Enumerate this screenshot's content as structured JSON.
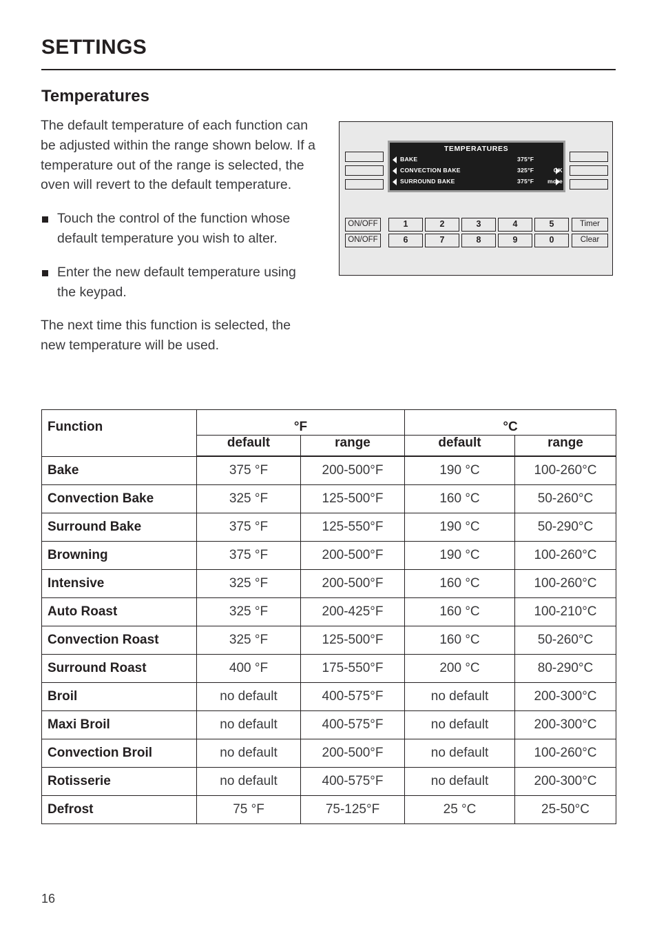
{
  "header": {
    "title": "SETTINGS"
  },
  "section": {
    "heading": "Temperatures",
    "intro": "The default temperature of each function can be adjusted within the range shown below. If a temperature out of the range is selected, the oven will revert to the default temperature.",
    "bullets": [
      "Touch the control of the function whose default temperature you wish to alter.",
      "Enter the new default temperature using the keypad."
    ],
    "closing": "The next time this function is selected, the new temperature will be used."
  },
  "control_panel": {
    "display": {
      "title": "TEMPERATURES",
      "rows": [
        {
          "label": "BAKE",
          "temp": "375°F",
          "action": ""
        },
        {
          "label": "CONVECTION BAKE",
          "temp": "325°F",
          "action": "OK"
        },
        {
          "label": "SURROUND BAKE",
          "temp": "375°F",
          "action": "more"
        }
      ]
    },
    "left_blank_buttons": [
      "",
      "",
      ""
    ],
    "right_blank_buttons": [
      "",
      "",
      ""
    ],
    "onoff_buttons": [
      "ON/OFF",
      "ON/OFF"
    ],
    "keypad_row1": [
      "1",
      "2",
      "3",
      "4",
      "5"
    ],
    "keypad_row2": [
      "6",
      "7",
      "8",
      "9",
      "0"
    ],
    "function_buttons": [
      "Timer",
      "Clear"
    ]
  },
  "table": {
    "headers": {
      "function": "Function",
      "fahrenheit": "°F",
      "celsius": "°C",
      "f_default": "default",
      "f_range": "range",
      "c_default": "default",
      "c_range": "range"
    },
    "rows": [
      {
        "function": "Bake",
        "f_default": "375 °F",
        "f_range": "200-500°F",
        "c_default": "190 °C",
        "c_range": "100-260°C"
      },
      {
        "function": "Convection Bake",
        "f_default": "325 °F",
        "f_range": "125-500°F",
        "c_default": "160 °C",
        "c_range": "50-260°C"
      },
      {
        "function": "Surround Bake",
        "f_default": "375 °F",
        "f_range": "125-550°F",
        "c_default": "190 °C",
        "c_range": "50-290°C"
      },
      {
        "function": "Browning",
        "f_default": "375 °F",
        "f_range": "200-500°F",
        "c_default": "190 °C",
        "c_range": "100-260°C"
      },
      {
        "function": "Intensive",
        "f_default": "325 °F",
        "f_range": "200-500°F",
        "c_default": "160 °C",
        "c_range": "100-260°C"
      },
      {
        "function": "Auto Roast",
        "f_default": "325 °F",
        "f_range": "200-425°F",
        "c_default": "160 °C",
        "c_range": "100-210°C"
      },
      {
        "function": "Convection Roast",
        "f_default": "325 °F",
        "f_range": "125-500°F",
        "c_default": "160 °C",
        "c_range": "50-260°C"
      },
      {
        "function": "Surround Roast",
        "f_default": "400 °F",
        "f_range": "175-550°F",
        "c_default": "200 °C",
        "c_range": "80-290°C"
      },
      {
        "function": "Broil",
        "f_default": "no default",
        "f_range": "400-575°F",
        "c_default": "no default",
        "c_range": "200-300°C"
      },
      {
        "function": "Maxi Broil",
        "f_default": "no default",
        "f_range": "400-575°F",
        "c_default": "no default",
        "c_range": "200-300°C"
      },
      {
        "function": "Convection Broil",
        "f_default": "no default",
        "f_range": "200-500°F",
        "c_default": "no default",
        "c_range": "100-260°C"
      },
      {
        "function": "Rotisserie",
        "f_default": "no default",
        "f_range": "400-575°F",
        "c_default": "no default",
        "c_range": "200-300°C"
      },
      {
        "function": "Defrost",
        "f_default": "75 °F",
        "f_range": "75-125°F",
        "c_default": "25 °C",
        "c_range": "25-50°C"
      }
    ]
  },
  "footer": {
    "page_number": "16"
  }
}
